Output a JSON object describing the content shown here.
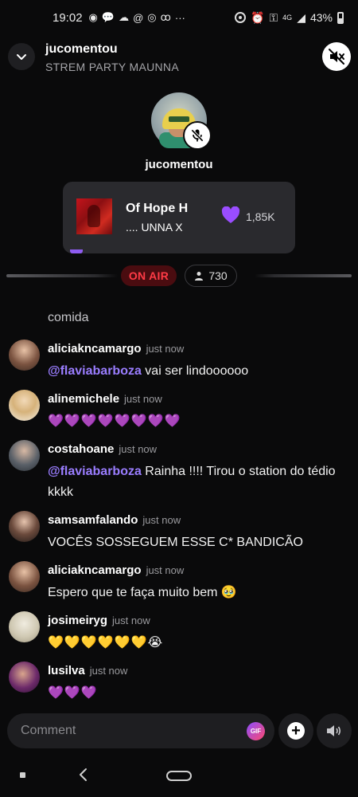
{
  "status_bar": {
    "time": "19:02",
    "network": "4G",
    "battery": "43%"
  },
  "header": {
    "host_name": "jucomentou",
    "room_name": "STREM PARTY MAUNNA"
  },
  "speaker": {
    "name": "jucomentou"
  },
  "music": {
    "title": "Of Hope       H",
    "artist": "....   UNNA X",
    "likes": "1,85K"
  },
  "room_status": {
    "on_air": "ON AIR",
    "listeners": "730"
  },
  "topic": "comida",
  "messages": [
    {
      "user": "aliciakncamargo",
      "time": "just now",
      "mention": "@flaviabarboza",
      "text": " vai ser lindoooooo"
    },
    {
      "user": "alinemichele",
      "time": "just now",
      "text": "💜💜💜💜💜💜💜💜"
    },
    {
      "user": "costahoane",
      "time": "just now",
      "mention": "@flaviabarboza",
      "text": " Rainha !!!! Tirou o station do tédio kkkk"
    },
    {
      "user": "samsamfalando",
      "time": "just now",
      "text": "VOCÊS SOSSEGUEM ESSE C*  BANDICÃO"
    },
    {
      "user": "aliciakncamargo",
      "time": "just now",
      "text": "Espero que te faça muito bem 🥹"
    },
    {
      "user": "josimeiryg",
      "time": "just now",
      "text": "💛💛💛💛💛💛😭"
    },
    {
      "user": "lusilva",
      "time": "just now",
      "text": "💜💜💜"
    }
  ],
  "composer": {
    "placeholder": "Comment",
    "gif_label": "GIF"
  },
  "colors": {
    "accent_purple": "#9a7dff",
    "on_air_red": "#ff3b46",
    "background": "#0a0a0b"
  }
}
